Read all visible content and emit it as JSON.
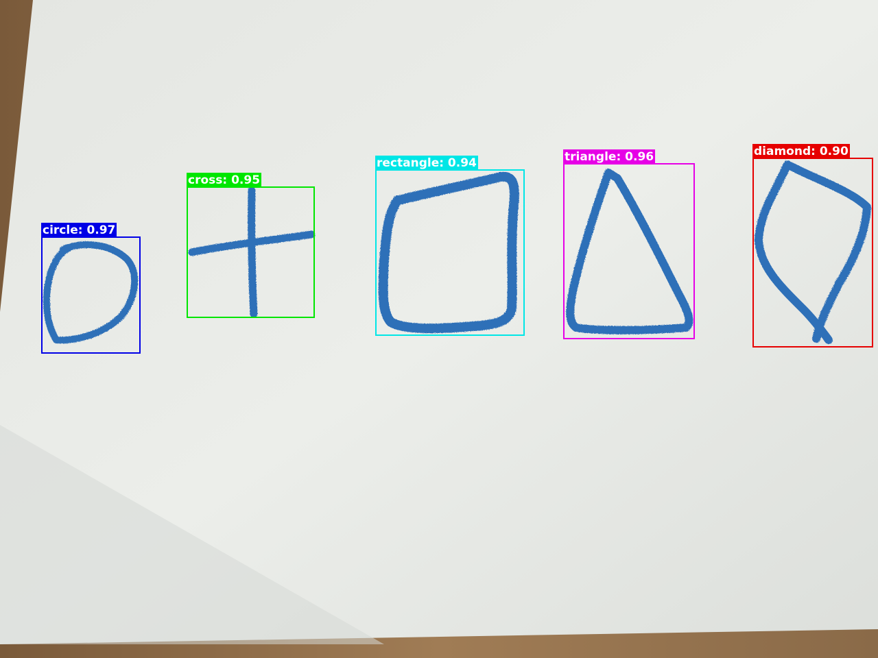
{
  "detections": [
    {
      "label": "circle",
      "score": "0.97",
      "caption": "circle: 0.97",
      "color": "#0000e6"
    },
    {
      "label": "cross",
      "score": "0.95",
      "caption": "cross: 0.95",
      "color": "#00e600"
    },
    {
      "label": "rectangle",
      "score": "0.94",
      "caption": "rectangle: 0.94",
      "color": "#00e6e6"
    },
    {
      "label": "triangle",
      "score": "0.96",
      "caption": "triangle: 0.96",
      "color": "#e600e6"
    },
    {
      "label": "diamond",
      "score": "0.90",
      "caption": "diamond: 0.90",
      "color": "#e60000"
    }
  ],
  "colors": {
    "paper": "#e9ebe7",
    "ink": "#2f6fb8",
    "table": "#8a6a48"
  }
}
